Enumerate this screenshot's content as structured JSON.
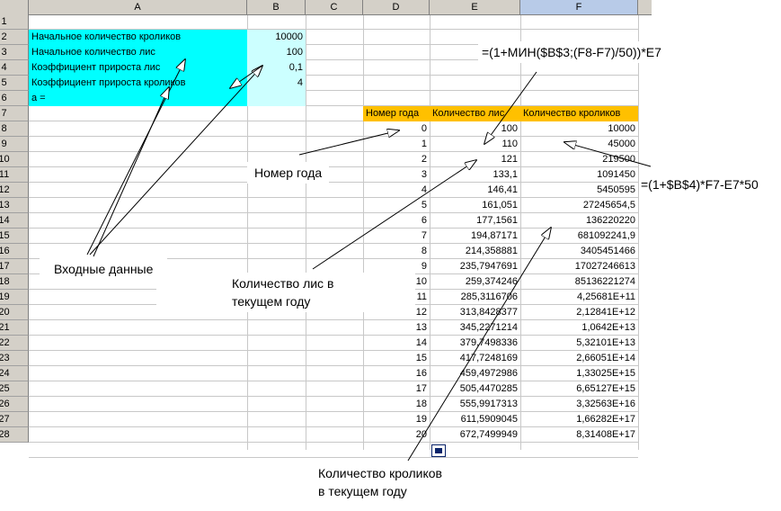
{
  "columns": [
    "A",
    "B",
    "C",
    "D",
    "E",
    "F"
  ],
  "row_numbers": [
    "1",
    "2",
    "3",
    "4",
    "5",
    "6",
    "7",
    "8",
    "9",
    "10",
    "11",
    "12",
    "13",
    "14",
    "15",
    "16",
    "17",
    "18",
    "19",
    "20",
    "21",
    "22",
    "23",
    "24",
    "25",
    "26",
    "27",
    "28"
  ],
  "inputs": {
    "rows": [
      {
        "label": "Начальное количество кроликов",
        "value": "10000"
      },
      {
        "label": "Начальное количество лис",
        "value": "100"
      },
      {
        "label": "Коэффициент прироста лис",
        "value": "0,1"
      },
      {
        "label": "Коэффициент прироста кроликов",
        "value": "4"
      },
      {
        "label": "a =",
        "value": ""
      }
    ]
  },
  "table": {
    "headers": [
      "Номер года",
      "Количество лис",
      "Количество кроликов"
    ],
    "rows": [
      [
        "0",
        "100",
        "10000"
      ],
      [
        "1",
        "110",
        "45000"
      ],
      [
        "2",
        "121",
        "219500"
      ],
      [
        "3",
        "133,1",
        "1091450"
      ],
      [
        "4",
        "146,41",
        "5450595"
      ],
      [
        "5",
        "161,051",
        "27245654,5"
      ],
      [
        "6",
        "177,1561",
        "136220220"
      ],
      [
        "7",
        "194,87171",
        "681092241,9"
      ],
      [
        "8",
        "214,358881",
        "3405451466"
      ],
      [
        "9",
        "235,7947691",
        "17027246613"
      ],
      [
        "10",
        "259,374246",
        "85136221274"
      ],
      [
        "11",
        "285,3116706",
        "4,25681E+11"
      ],
      [
        "12",
        "313,8428377",
        "2,12841E+12"
      ],
      [
        "13",
        "345,2271214",
        "1,0642E+13"
      ],
      [
        "14",
        "379,7498336",
        "5,32101E+13"
      ],
      [
        "15",
        "417,7248169",
        "2,66051E+14"
      ],
      [
        "16",
        "459,4972986",
        "1,33025E+15"
      ],
      [
        "17",
        "505,4470285",
        "6,65127E+15"
      ],
      [
        "18",
        "555,9917313",
        "3,32563E+16"
      ],
      [
        "19",
        "611,5909045",
        "1,66282E+17"
      ],
      [
        "20",
        "672,7499949",
        "8,31408E+17"
      ]
    ]
  },
  "callouts": {
    "formula_rabbits": "=(1+МИН($B$3;(F8-F7)/50))*E7",
    "formula_foxes": "=(1+$B$4)*F7-E7*50",
    "year_number": "Номер года",
    "input_data": "Входные данные",
    "foxes_line1": "Количество лис в",
    "foxes_line2": "текущем году",
    "rabbits_line1": "Количество кроликов",
    "rabbits_line2": "в текущем году"
  }
}
